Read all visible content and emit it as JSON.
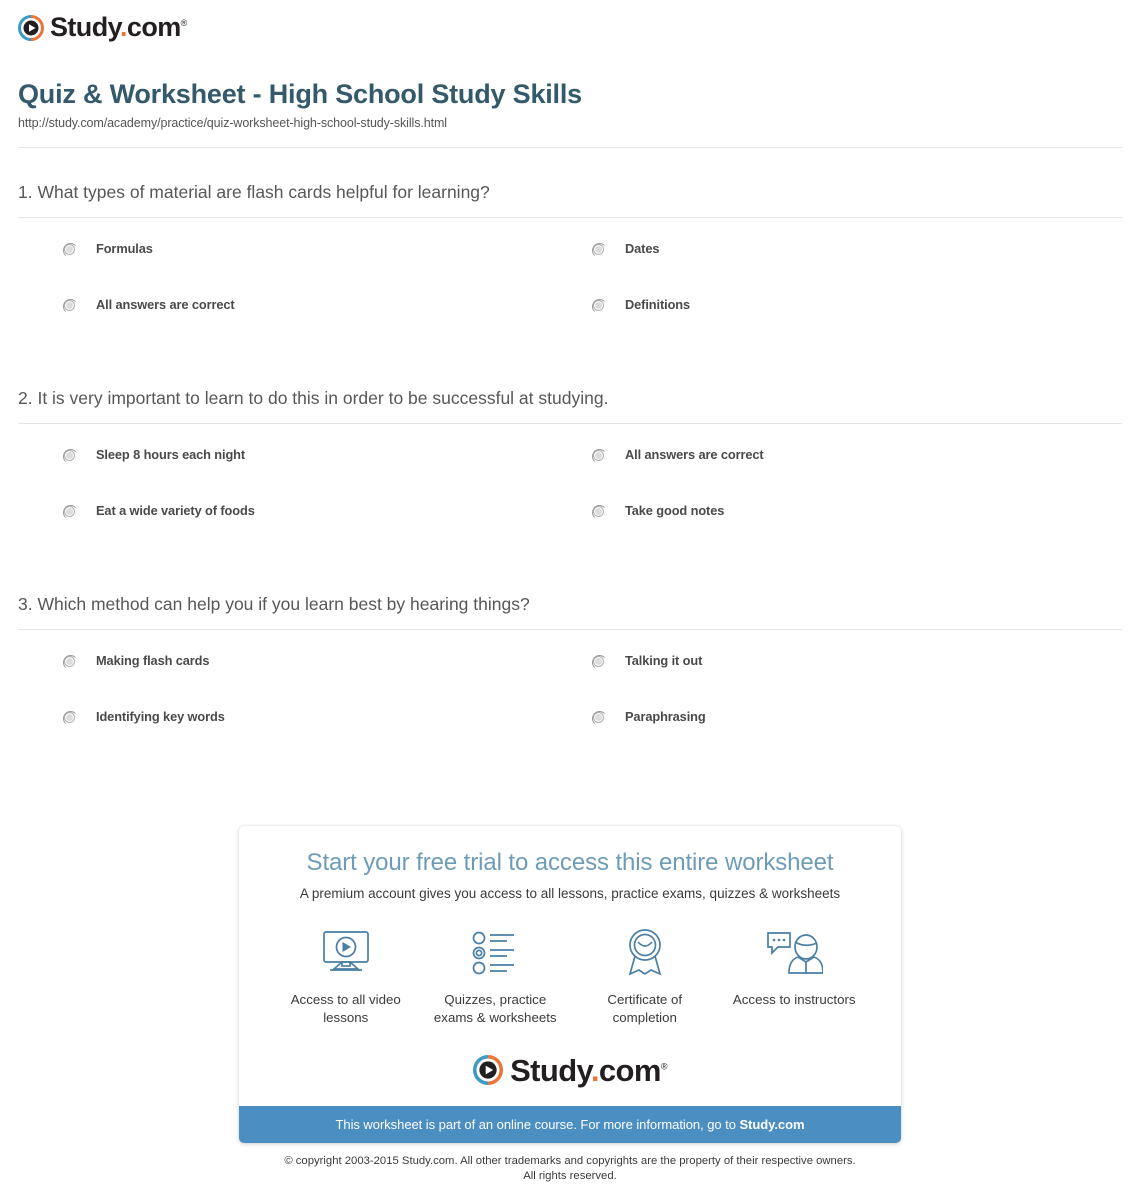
{
  "brand": {
    "name_main": "Study",
    "name_dot": ".",
    "name_tld": "com",
    "trademark": "®",
    "mark_icon": "play-circle-icon",
    "colors": {
      "ring_blue": "#3c9ac4",
      "ring_orange": "#e8763a",
      "dot": "#e8763a",
      "text": "#231f20"
    }
  },
  "header": {
    "title": "Quiz & Worksheet - High School Study Skills",
    "url": "http://study.com/academy/practice/quiz-worksheet-high-school-study-skills.html",
    "title_color": "#33596b"
  },
  "questions": [
    {
      "number": "1.",
      "text": "1. What types of material are flash cards helpful for learning?",
      "answers": [
        "Formulas",
        "Dates",
        "All answers are correct",
        "Definitions"
      ]
    },
    {
      "number": "2.",
      "text": "2. It is very important to learn to do this in order to be successful at studying.",
      "answers": [
        "Sleep 8 hours each night",
        "All answers are correct",
        "Eat a wide variety of foods",
        "Take good notes"
      ]
    },
    {
      "number": "3.",
      "text": "3. Which method can help you if you learn best by hearing things?",
      "answers": [
        "Making flash cards",
        "Talking it out",
        "Identifying key words",
        "Paraphrasing"
      ]
    }
  ],
  "promo": {
    "heading": "Start your free trial to access this entire worksheet",
    "subheading": "A premium account gives you access to all lessons, practice exams, quizzes & worksheets",
    "heading_color": "#6e9cb8",
    "features": [
      {
        "icon": "monitor-play-icon",
        "label": "Access to all video lessons"
      },
      {
        "icon": "quiz-list-icon",
        "label": "Quizzes, practice exams & worksheets"
      },
      {
        "icon": "award-ribbon-icon",
        "label": "Certificate of completion"
      },
      {
        "icon": "instructor-chat-icon",
        "label": "Access to instructors"
      }
    ],
    "bar_text_plain": "This worksheet is part of an online course. For more information, go to ",
    "bar_text_bold": "Study.com",
    "bar_color": "#4b8ec2"
  },
  "footer": {
    "copyright_line1": "© copyright 2003-2015 Study.com. All other trademarks and copyrights are the property of their respective owners.",
    "copyright_line2": "All rights reserved."
  }
}
